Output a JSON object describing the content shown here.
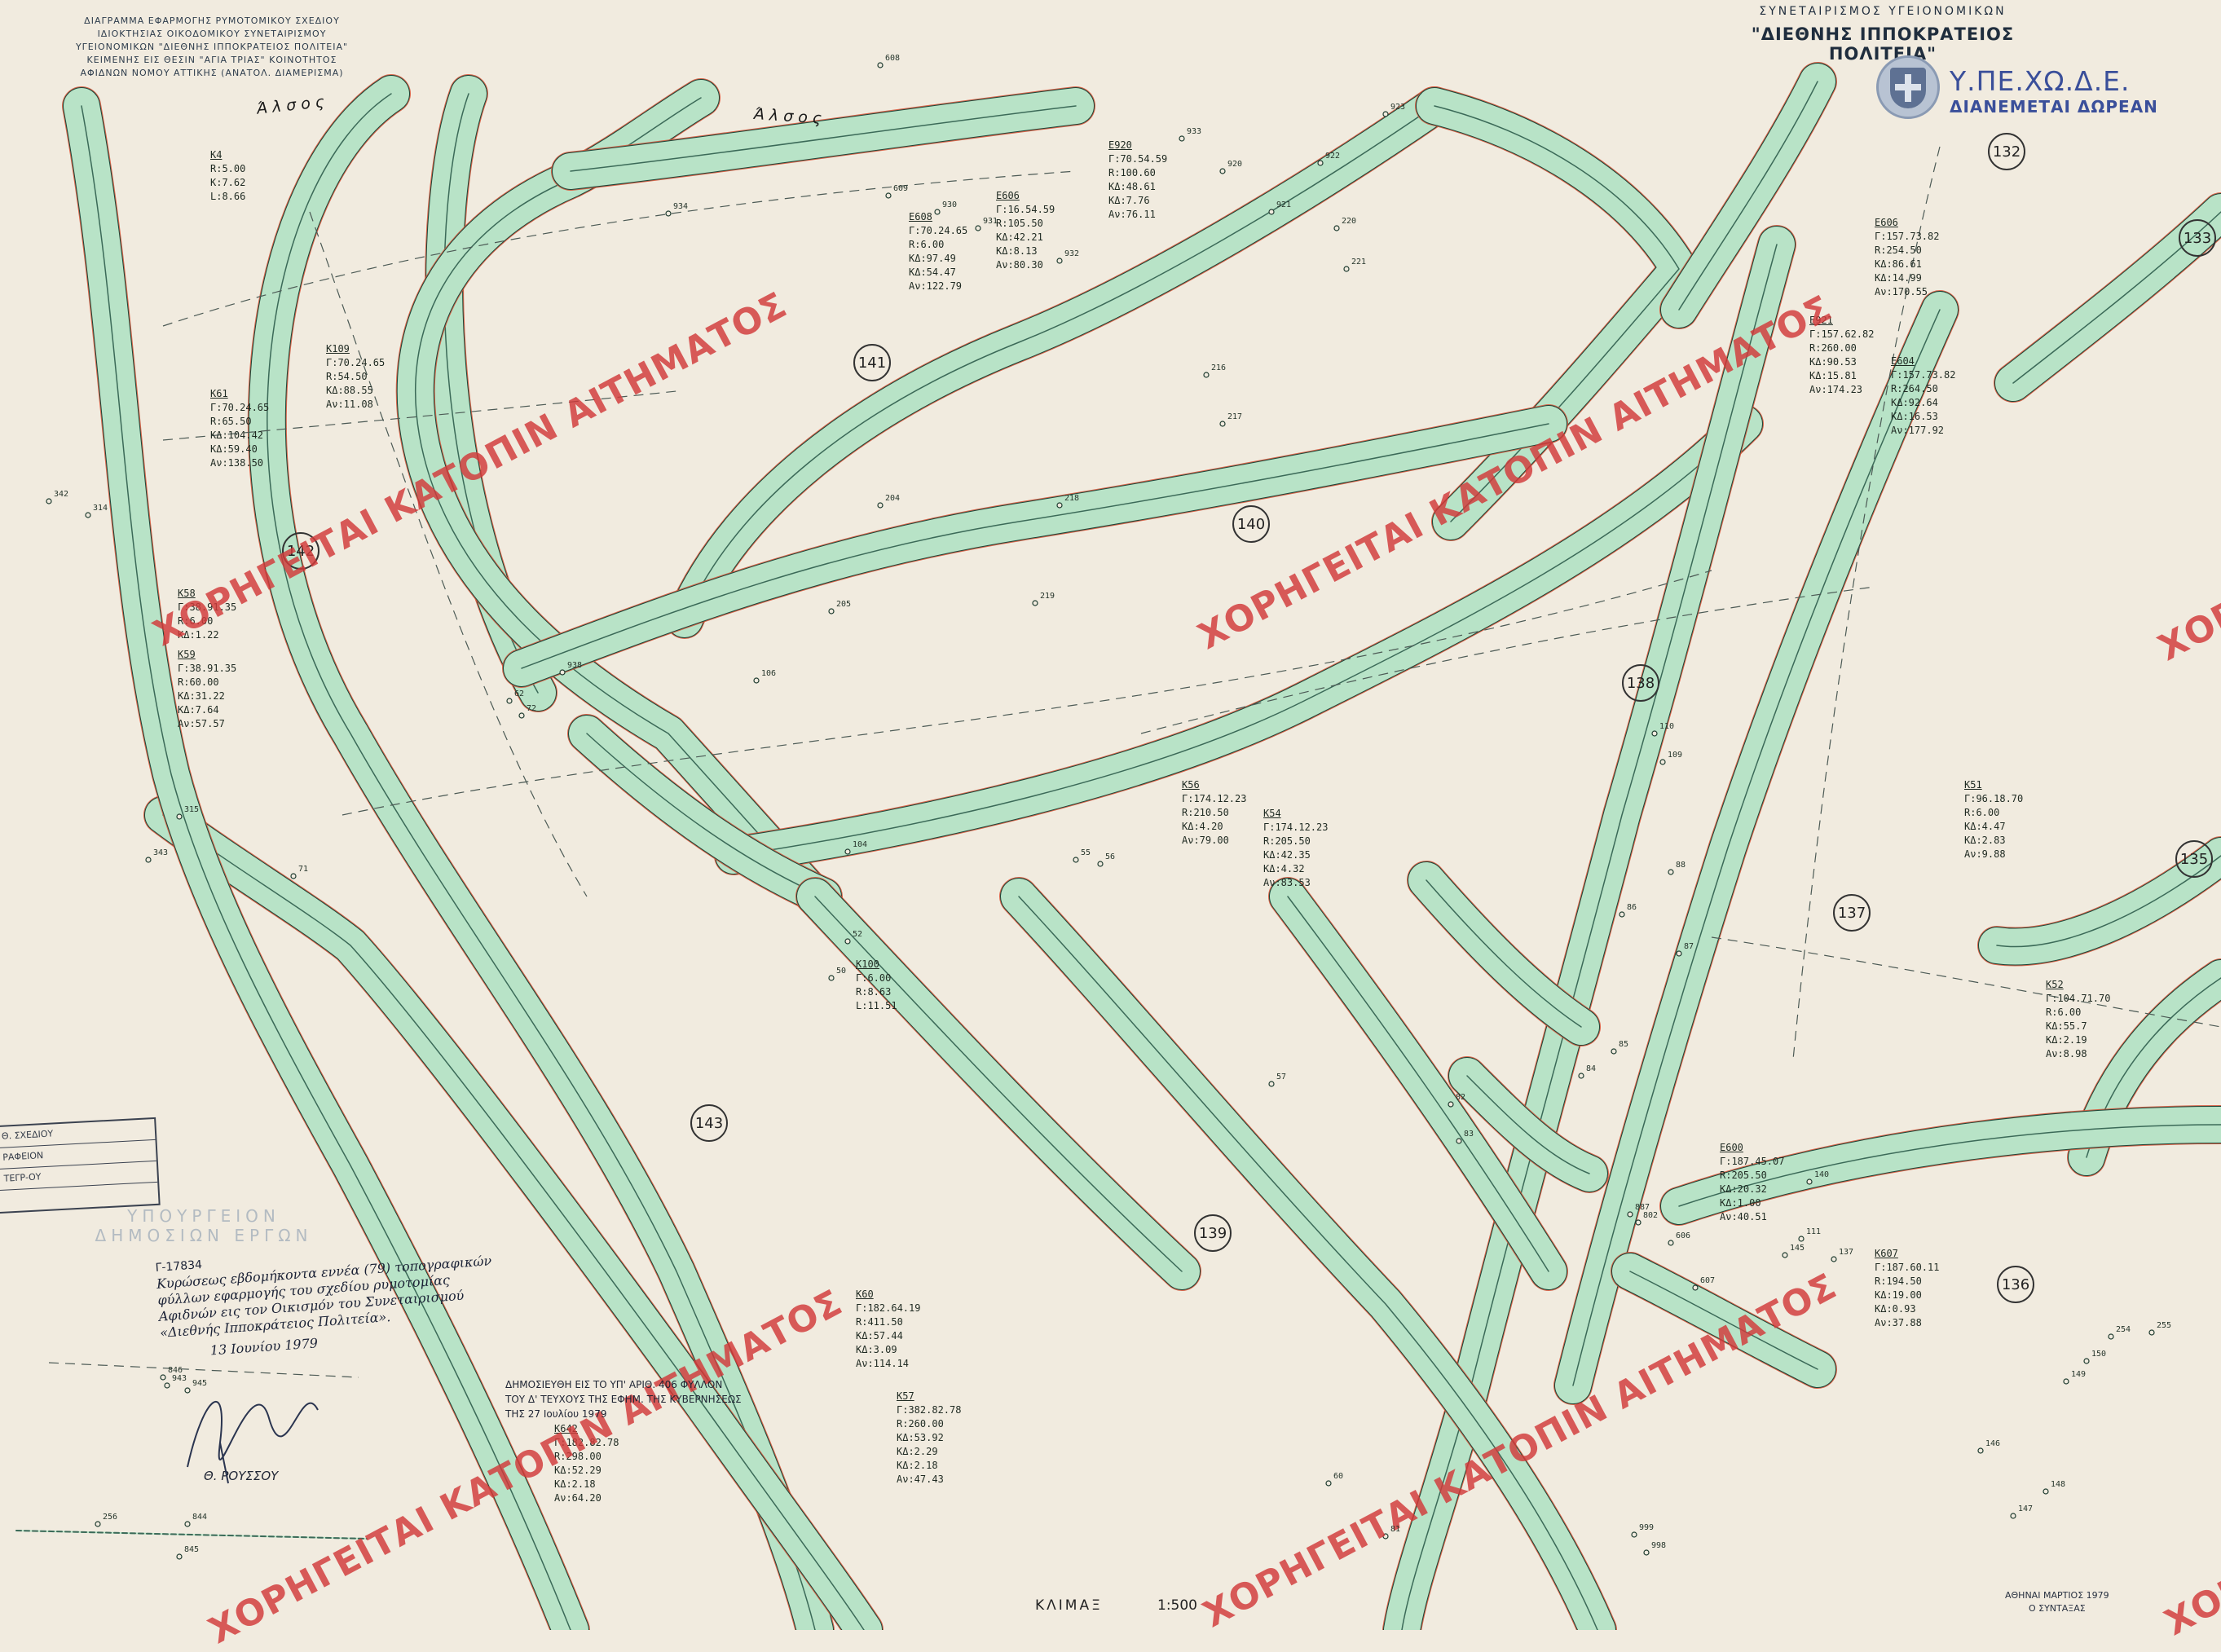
{
  "header": {
    "title_lines": "ΔΙΑΓΡΑΜΜΑ ΕΦΑΡΜΟΓΗΣ ΡΥΜΟΤΟΜΙΚΟΥ ΣΧΕΔΙΟΥ\nΙΔΙΟΚΤΗΣΙΑΣ ΟΙΚΟΔΟΜΙΚΟΥ ΣΥΝΕΤΑΙΡΙΣΜΟΥ\nΥΓΕΙΟΝΟΜΙΚΩΝ \"ΔΙΕΘΝΗΣ ΙΠΠΟΚΡΑΤΕΙΟΣ ΠΟΛΙΤΕΙΑ\"\nΚΕΙΜΕΝΗΣ ΕΙΣ ΘΕΣΙΝ \"ΑΓΙΑ ΤΡΙΑΣ\" ΚΟΙΝΟΤΗΤΟΣ\nΑΦΙΔΝΩΝ ΝΟΜΟΥ ΑΤΤΙΚΗΣ (ΑΝΑΤΟΛ. ΔΙΑΜΕΡΙΣΜΑ)",
    "organization": "ΣΥΝΕΤΑΙΡΙΣΜΟΣ ΥΓΕΙΟΝΟΜΙΚΩΝ",
    "project_name": "\"ΔΙΕΘΝΗΣ ΙΠΠΟΚΡΑΤΕΙΟΣ ΠΟΛΙΤΕΙΑ\"",
    "ministry": "Υ.ΠΕ.ΧΩ.Δ.Ε.",
    "distribution": "ΔΙΑΝΕΜΕΤΑΙ ΔΩΡΕΑΝ"
  },
  "watermark_text": "ΧΟΡΗΓΕΙΤΑΙ ΚΑΤΟΠΙΝ ΑΙΤΗΜΑΤΟΣ",
  "area_labels": [
    "Άλσος",
    "Άλσος"
  ],
  "blocks": [
    "141",
    "140",
    "142",
    "138",
    "143",
    "139",
    "137",
    "136",
    "132",
    "133",
    "135"
  ],
  "curve_labels": [
    {
      "name": "Κ109",
      "lines": "Γ:70.24.65\nR:54.50\nΚΔ:88.55\nΑν:11.08"
    },
    {
      "name": "Κ61",
      "lines": "Γ:70.24.65\nR:65.50\nΚΔ:104.42\nΚΔ:59.40\nΑν:138.50"
    },
    {
      "name": "Κ58",
      "lines": "Γ:38.91.35\nR:6.00\nΚΔ:1.22"
    },
    {
      "name": "Κ59",
      "lines": "Γ:38.91.35\nR:60.00\nΚΔ:31.22\nΚΔ:7.64\nΑν:57.57"
    },
    {
      "name": "Ε920",
      "lines": "Γ:70.54.59\nR:100.60\nΚΔ:48.61\nΚΔ:7.76\nΑν:76.11"
    },
    {
      "name": "Ε606",
      "lines": "Γ:16.54.59\nR:105.50\nΚΔ:42.21\nΚΔ:8.13\nΑν:80.30"
    },
    {
      "name": "Ε608",
      "lines": "Γ:70.24.65\nR:6.00\nΚΔ:97.49\nΚΔ:54.47\nΑν:122.79"
    },
    {
      "name": "Κ54",
      "lines": "Γ:174.12.23\nR:205.50\nΚΔ:42.35\nΚΔ:4.32\nΑν:83.53"
    },
    {
      "name": "Κ56",
      "lines": "Γ:174.12.23\nR:210.50\nΚΔ:4.20\nΑν:79.00"
    },
    {
      "name": "Κ57",
      "lines": "Γ:382.82.78\nR:260.00\nΚΔ:53.92\nΚΔ:2.29\nΚΔ:2.18\nΑν:47.43"
    },
    {
      "name": "Κ642",
      "lines": "Γ:182.82.78\nR:298.00\nΚΔ:52.29\nΚΔ:2.18\nΑν:64.20"
    },
    {
      "name": "Κ60",
      "lines": "Γ:182.64.19\nR:411.50\nΚΔ:57.44\nΚΔ:3.09\nΑν:114.14"
    },
    {
      "name": "Ε600",
      "lines": "Γ:187.45.07\nR:205.50\nΚΔ:20.32\nΚΔ:1.00\nΑν:40.51"
    },
    {
      "name": "Κ607",
      "lines": "Γ:187.60.11\nR:194.50\nΚΔ:19.00\nΚΔ:0.93\nΑν:37.88"
    },
    {
      "name": "Ε606",
      "lines": "Γ:157.73.82\nR:254.50\nΚΔ:86.61\nΚΔ:14.99\nΑν:170.55"
    },
    {
      "name": "Ε604",
      "lines": "Γ:157.73.82\nR:264.50\nΚΔ:92.64\nΚΔ:16.53\nΑν:177.92"
    },
    {
      "name": "Ε921",
      "lines": "Γ:157.62.82\nR:260.00\nΚΔ:90.53\nΚΔ:15.81\nΑν:174.23"
    },
    {
      "name": "Κ51",
      "lines": "Γ:96.18.70\nR:6.00\nΚΔ:4.47\nΚΔ:2.83\nΑν:9.88"
    },
    {
      "name": "Κ52",
      "lines": "Γ:104.71.70\nR:6.00\nΚΔ:55.7\nΚΔ:2.19\nΑν:8.98"
    },
    {
      "name": "Κ4",
      "lines": "R:5.00\nΚ:7.62\nL:8.66"
    },
    {
      "name": "Κ100",
      "lines": "Γ:6.00\nR:8.63\nL:11.51"
    }
  ],
  "approval": {
    "ref": "Γ-17834",
    "text": "Κυρώσεως εβδομήκοντα εννέα (79) τοπογραφικών φύλλων εφαρμογής του σχεδίου ρυμοτομίας Αφιδνών εις τον Οικισμόν του Συνεταιρισμού «Διεθνής Ιπποκράτειος Πολιτεία».",
    "date": "13 Ιουνίου 1979",
    "signer": "Θ. ΡΟΥΣΣΟΥ"
  },
  "publication": "ΔΗΜΟΣΙΕΥΘΗ ΕΙΣ ΤΟ ΥΠ' ΑΡΙΘ. 406 ΦΥΛΛΟΝ\nΤΟΥ Δ' ΤΕΥΧΟΥΣ ΤΗΣ ΕΦΗΜ. ΤΗΣ ΚΥΒΕΡΝΗΣΕΩΣ\nΤΗΣ 27 Ιουλίου 1979",
  "stamp_rows": [
    "Θ. ΣΧΕΔΙΟΥ",
    "ΡΑΦΕΙΟΝ",
    "ΤΕΓΡ-ΟΥ"
  ],
  "stamp_faded": "ΥΠΟΥΡΓΕΙΟΝ ΔΗΜΟΣΙΩΝ ΕΡΓΩΝ",
  "scale_label": "ΚΛΙΜΑΞ",
  "scale_value": "1:500",
  "place_date": "ΑΘΗΝΑΙ ΜΑΡΤΙΟΣ 1979\nΟ ΣΥΝΤΑΞΑΣ",
  "node_ids": [
    "342",
    "314",
    "315",
    "343",
    "62",
    "72",
    "71",
    "938",
    "934",
    "220",
    "221",
    "216",
    "217",
    "218",
    "219",
    "205",
    "204",
    "106",
    "104",
    "50",
    "52",
    "55",
    "56",
    "57",
    "60",
    "81",
    "82",
    "83",
    "84",
    "85",
    "86",
    "87",
    "88",
    "109",
    "110",
    "111",
    "137",
    "140",
    "145",
    "146",
    "147",
    "148",
    "149",
    "150",
    "254",
    "255",
    "256",
    "844",
    "845",
    "846",
    "943",
    "945",
    "999",
    "998",
    "887",
    "802",
    "606",
    "607",
    "608",
    "609",
    "930",
    "931",
    "932",
    "933",
    "920",
    "921",
    "922",
    "923"
  ]
}
